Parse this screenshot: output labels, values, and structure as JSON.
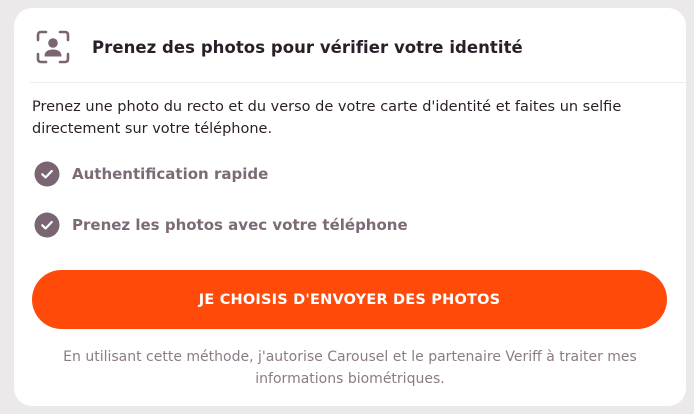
{
  "header": {
    "icon": "face-scan-icon",
    "title": "Prenez des photos pour vérifier votre identité"
  },
  "description": "Prenez une photo du recto et du verso de votre carte d'identité et faites un selfie directement sur votre téléphone.",
  "features": [
    {
      "icon": "check-circle-icon",
      "label": "Authentification rapide"
    },
    {
      "icon": "check-circle-icon",
      "label": "Prenez les photos avec votre téléphone"
    }
  ],
  "cta": {
    "label": "JE CHOISIS D'ENVOYER DES PHOTOS"
  },
  "consent": "En utilisant cette méthode, j'autorise Carousel et le partenaire Veriff à traiter mes informations biométriques.",
  "colors": {
    "accent": "#ff4a0a",
    "title_text": "#2a1f28",
    "feature_text": "#7c6b77",
    "check_bg": "#7a6673",
    "muted_text": "#8b7b86",
    "page_bg": "#ece9ea",
    "card_bg": "#ffffff"
  }
}
